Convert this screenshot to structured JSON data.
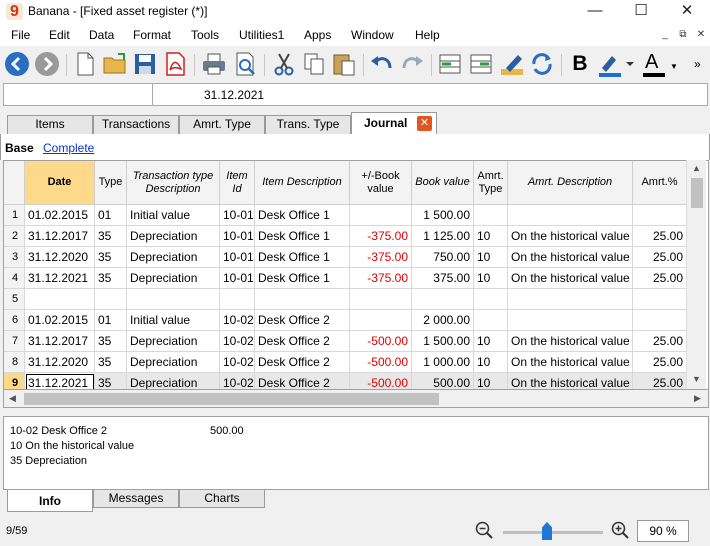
{
  "window": {
    "title": "Banana - [Fixed asset register (*)]",
    "logo": "9"
  },
  "menu": [
    "File",
    "Edit",
    "Data",
    "Format",
    "Tools",
    "Utilities1",
    "Apps",
    "Window",
    "Help"
  ],
  "toolbar_icons": [
    "back-icon",
    "forward-icon",
    "new-file-icon",
    "open-folder-icon",
    "save-icon",
    "pdf-icon",
    "print-icon",
    "print-preview-icon",
    "cut-icon",
    "copy-icon",
    "paste-icon",
    "undo-icon",
    "redo-icon",
    "add-rows-icon",
    "delete-rows-icon",
    "edit-icon",
    "recalculate-icon",
    "bold-icon",
    "highlight-icon",
    "text-color-icon",
    "more-icon"
  ],
  "toolbar": {
    "bold_label": "B",
    "text_color_label": "A"
  },
  "address": {
    "value": "31.12.2021"
  },
  "tabs": [
    "Items",
    "Transactions",
    "Amrt. Type",
    "Trans. Type",
    "Journal"
  ],
  "active_tab": "Journal",
  "views": {
    "base": "Base",
    "complete": "Complete"
  },
  "table": {
    "columns": [
      "Date",
      "Type",
      "Transaction type Description",
      "Item Id",
      "Item Description",
      "+/-Book value",
      "Book value",
      "Amrt. Type",
      "Amrt. Description",
      "Amrt.%"
    ],
    "rows": [
      [
        "1",
        "01.02.2015",
        "01",
        "Initial value",
        "10-01",
        "Desk Office 1",
        "",
        "1 500.00",
        "",
        "",
        ""
      ],
      [
        "2",
        "31.12.2017",
        "35",
        "Depreciation",
        "10-01",
        "Desk Office 1",
        "-375.00",
        "1 125.00",
        "10",
        "On the historical value",
        "25.00"
      ],
      [
        "3",
        "31.12.2020",
        "35",
        "Depreciation",
        "10-01",
        "Desk Office 1",
        "-375.00",
        "750.00",
        "10",
        "On the historical value",
        "25.00"
      ],
      [
        "4",
        "31.12.2021",
        "35",
        "Depreciation",
        "10-01",
        "Desk Office 1",
        "-375.00",
        "375.00",
        "10",
        "On the historical value",
        "25.00"
      ],
      [
        "5",
        "",
        "",
        "",
        "",
        "",
        "",
        "",
        "",
        "",
        ""
      ],
      [
        "6",
        "01.02.2015",
        "01",
        "Initial value",
        "10-02",
        "Desk Office 2",
        "",
        "2 000.00",
        "",
        "",
        ""
      ],
      [
        "7",
        "31.12.2017",
        "35",
        "Depreciation",
        "10-02",
        "Desk Office 2",
        "-500.00",
        "1 500.00",
        "10",
        "On the historical value",
        "25.00"
      ],
      [
        "8",
        "31.12.2020",
        "35",
        "Depreciation",
        "10-02",
        "Desk Office 2",
        "-500.00",
        "1 000.00",
        "10",
        "On the historical value",
        "25.00"
      ],
      [
        "9",
        "31.12.2021",
        "35",
        "Depreciation",
        "10-02",
        "Desk Office 2",
        "-500.00",
        "500.00",
        "10",
        "On the historical value",
        "25.00"
      ]
    ]
  },
  "info": {
    "line1": "10-02 Desk Office 2",
    "line1_value": "500.00",
    "line2": "10 On the historical value",
    "line3": "35 Depreciation"
  },
  "bottom_tabs": [
    "Info",
    "Messages",
    "Charts"
  ],
  "status": {
    "position": "9/59",
    "zoom": "90  %"
  }
}
